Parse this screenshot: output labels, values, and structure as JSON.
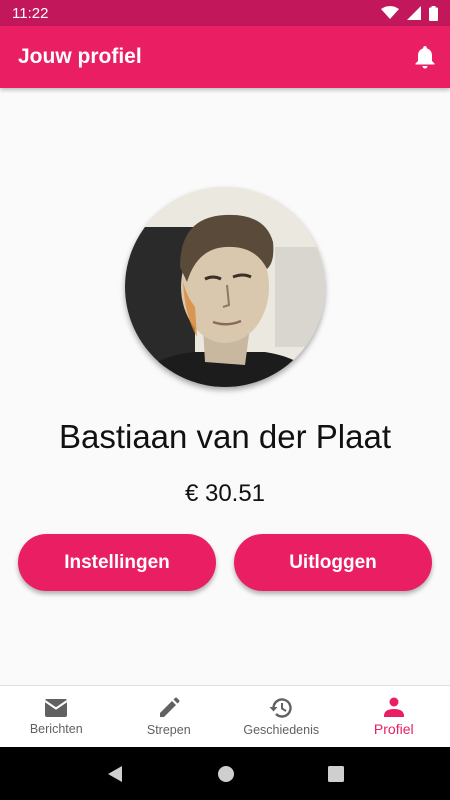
{
  "status_bar": {
    "time": "11:22"
  },
  "app_bar": {
    "title": "Jouw profiel",
    "notification_icon": "bell-icon"
  },
  "profile": {
    "name": "Bastiaan van der Plaat",
    "balance": "€ 30.51",
    "settings_label": "Instellingen",
    "logout_label": "Uitloggen"
  },
  "bottom_nav": {
    "items": [
      {
        "label": "Berichten",
        "icon": "mail-icon"
      },
      {
        "label": "Strepen",
        "icon": "pencil-icon"
      },
      {
        "label": "Geschiedenis",
        "icon": "history-icon"
      },
      {
        "label": "Profiel",
        "icon": "person-icon",
        "active": true
      }
    ]
  },
  "colors": {
    "primary": "#e91e63",
    "primary_dark": "#c2185b",
    "nav_inactive": "#616161"
  }
}
